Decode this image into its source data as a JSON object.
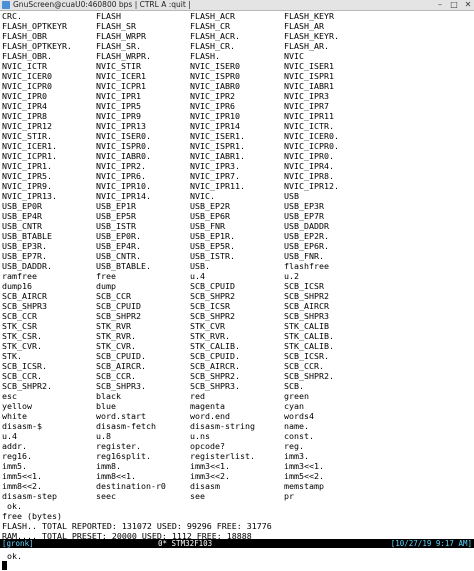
{
  "window": {
    "title": "GnuScreen@cuaU0:460800 bps | CTRL A :quit |",
    "buttons": [
      "–",
      "□",
      "✕"
    ]
  },
  "words": [
    "CRC.",
    "FLASH",
    "FLASH_ACR",
    "FLASH_KEYR",
    "FLASH_OPTKEYR",
    "FLASH_SR",
    "FLASH_CR",
    "FLASH_AR",
    "FLASH_OBR",
    "FLASH_WRPR",
    "FLASH_ACR.",
    "FLASH_KEYR.",
    "FLASH_OPTKEYR.",
    "FLASH_SR.",
    "FLASH_CR.",
    "FLASH_AR.",
    "FLASH_OBR.",
    "FLASH_WRPR.",
    "FLASH.",
    "NVIC",
    "NVIC_ICTR",
    "NVIC_STIR",
    "NVIC_ISER0",
    "NVIC_ISER1",
    "NVIC_ICER0",
    "NVIC_ICER1",
    "NVIC_ISPR0",
    "NVIC_ISPR1",
    "NVIC_ICPR0",
    "NVIC_ICPR1",
    "NVIC_IABR0",
    "NVIC_IABR1",
    "NVIC_IPR0",
    "NVIC_IPR1",
    "NVIC_IPR2",
    "NVIC_IPR3",
    "NVIC_IPR4",
    "NVIC_IPR5",
    "NVIC_IPR6",
    "NVIC_IPR7",
    "NVIC_IPR8",
    "NVIC_IPR9",
    "NVIC_IPR10",
    "NVIC_IPR11",
    "NVIC_IPR12",
    "NVIC_IPR13",
    "NVIC_IPR14",
    "NVIC_ICTR.",
    "NVIC_STIR.",
    "NVIC_ISER0.",
    "NVIC_ISER1.",
    "NVIC_ICER0.",
    "NVIC_ICER1.",
    "NVIC_ISPR0.",
    "NVIC_ISPR1.",
    "NVIC_ICPR0.",
    "NVIC_ICPR1.",
    "NVIC_IABR0.",
    "NVIC_IABR1.",
    "NVIC_IPR0.",
    "NVIC_IPR1.",
    "NVIC_IPR2.",
    "NVIC_IPR3.",
    "NVIC_IPR4.",
    "NVIC_IPR5.",
    "NVIC_IPR6.",
    "NVIC_IPR7.",
    "NVIC_IPR8.",
    "NVIC_IPR9.",
    "NVIC_IPR10.",
    "NVIC_IPR11.",
    "NVIC_IPR12.",
    "NVIC_IPR13.",
    "NVIC_IPR14.",
    "NVIC.",
    "USB",
    "USB_EP0R",
    "USB_EP1R",
    "USB_EP2R",
    "USB_EP3R",
    "USB_EP4R",
    "USB_EP5R",
    "USB_EP6R",
    "USB_EP7R",
    "USB_CNTR",
    "USB_ISTR",
    "USB_FNR",
    "USB_DADDR",
    "USB_BTABLE",
    "USB_EP0R.",
    "USB_EP1R.",
    "USB_EP2R.",
    "USB_EP3R.",
    "USB_EP4R.",
    "USB_EP5R.",
    "USB_EP6R.",
    "USB_EP7R.",
    "USB_CNTR.",
    "USB_ISTR.",
    "USB_FNR.",
    "USB_DADDR.",
    "USB_BTABLE.",
    "USB.",
    "flashfree",
    "ramfree",
    "free",
    "u.4",
    "u.2",
    "dump16",
    "dump",
    "SCB_CPUID",
    "SCB_ICSR",
    "SCB_AIRCR",
    "SCB_CCR",
    "SCB_SHPR2",
    "SCB_SHPR2",
    "SCB_SHPR3",
    "SCB_CPUID",
    "SCB_ICSR",
    "SCB_AIRCR",
    "SCB_CCR",
    "SCB_SHPR2",
    "SCB_SHPR2",
    "SCB_SHPR3",
    "STK_CSR",
    "STK_RVR",
    "STK_CVR",
    "STK_CALIB",
    "STK_CSR.",
    "STK_RVR.",
    "STK_RVR.",
    "STK_CALIB.",
    "STK_CVR.",
    "STK_CVR.",
    "STK_CALIB.",
    "STK_CALIB.",
    "STK.",
    "SCB_CPUID.",
    "SCB_CPUID.",
    "SCB_ICSR.",
    "SCB_ICSR.",
    "SCB_AIRCR.",
    "SCB_AIRCR.",
    "SCB_CCR.",
    "SCB_CCR.",
    "SCB_CCR.",
    "SCB_SHPR2.",
    "SCB_SHPR2.",
    "SCB_SHPR2.",
    "SCB_SHPR3.",
    "SCB_SHPR3.",
    "SCB.",
    "esc",
    "black",
    "red",
    "green",
    "yellow",
    "blue",
    "magenta",
    "cyan",
    "white",
    "word.start",
    "word.end",
    "words4",
    "disasm-$",
    "disasm-fetch",
    "disasm-string",
    "name.",
    "u.4",
    "u.8",
    "u.ns",
    "const.",
    "addr.",
    "register.",
    "opcode?",
    "reg.",
    "reg16.",
    "reg16split.",
    "registerlist.",
    "imm3.",
    "imm5.",
    "imm8.",
    "imm3<<1.",
    "imm3<<1.",
    "imm5<<1.",
    "imm8<<1.",
    "imm3<<2.",
    "imm5<<2.",
    "imm8<<2.",
    "destination-r0",
    "disasm",
    "memstamp",
    "disasm-step",
    "seec",
    "see",
    "pr"
  ],
  "tail": [
    " ok.",
    "free (bytes)",
    "FLASH.. TOTAL REPORTED: 131072 USED: 99296 FREE: 31776",
    "RAM.... TOTAL PRESET: 20000 USED: 1112 FREE: 18888",
    "",
    " ok."
  ],
  "status": {
    "session": "[gronk]",
    "window": "0*  STM32F103",
    "datetime": "[10/27/19  9:17 AM]"
  },
  "colors": {
    "status_bg": "#000000",
    "status_accent": "#5fd7ff",
    "titlebar_bg": "#e4e4e4"
  }
}
